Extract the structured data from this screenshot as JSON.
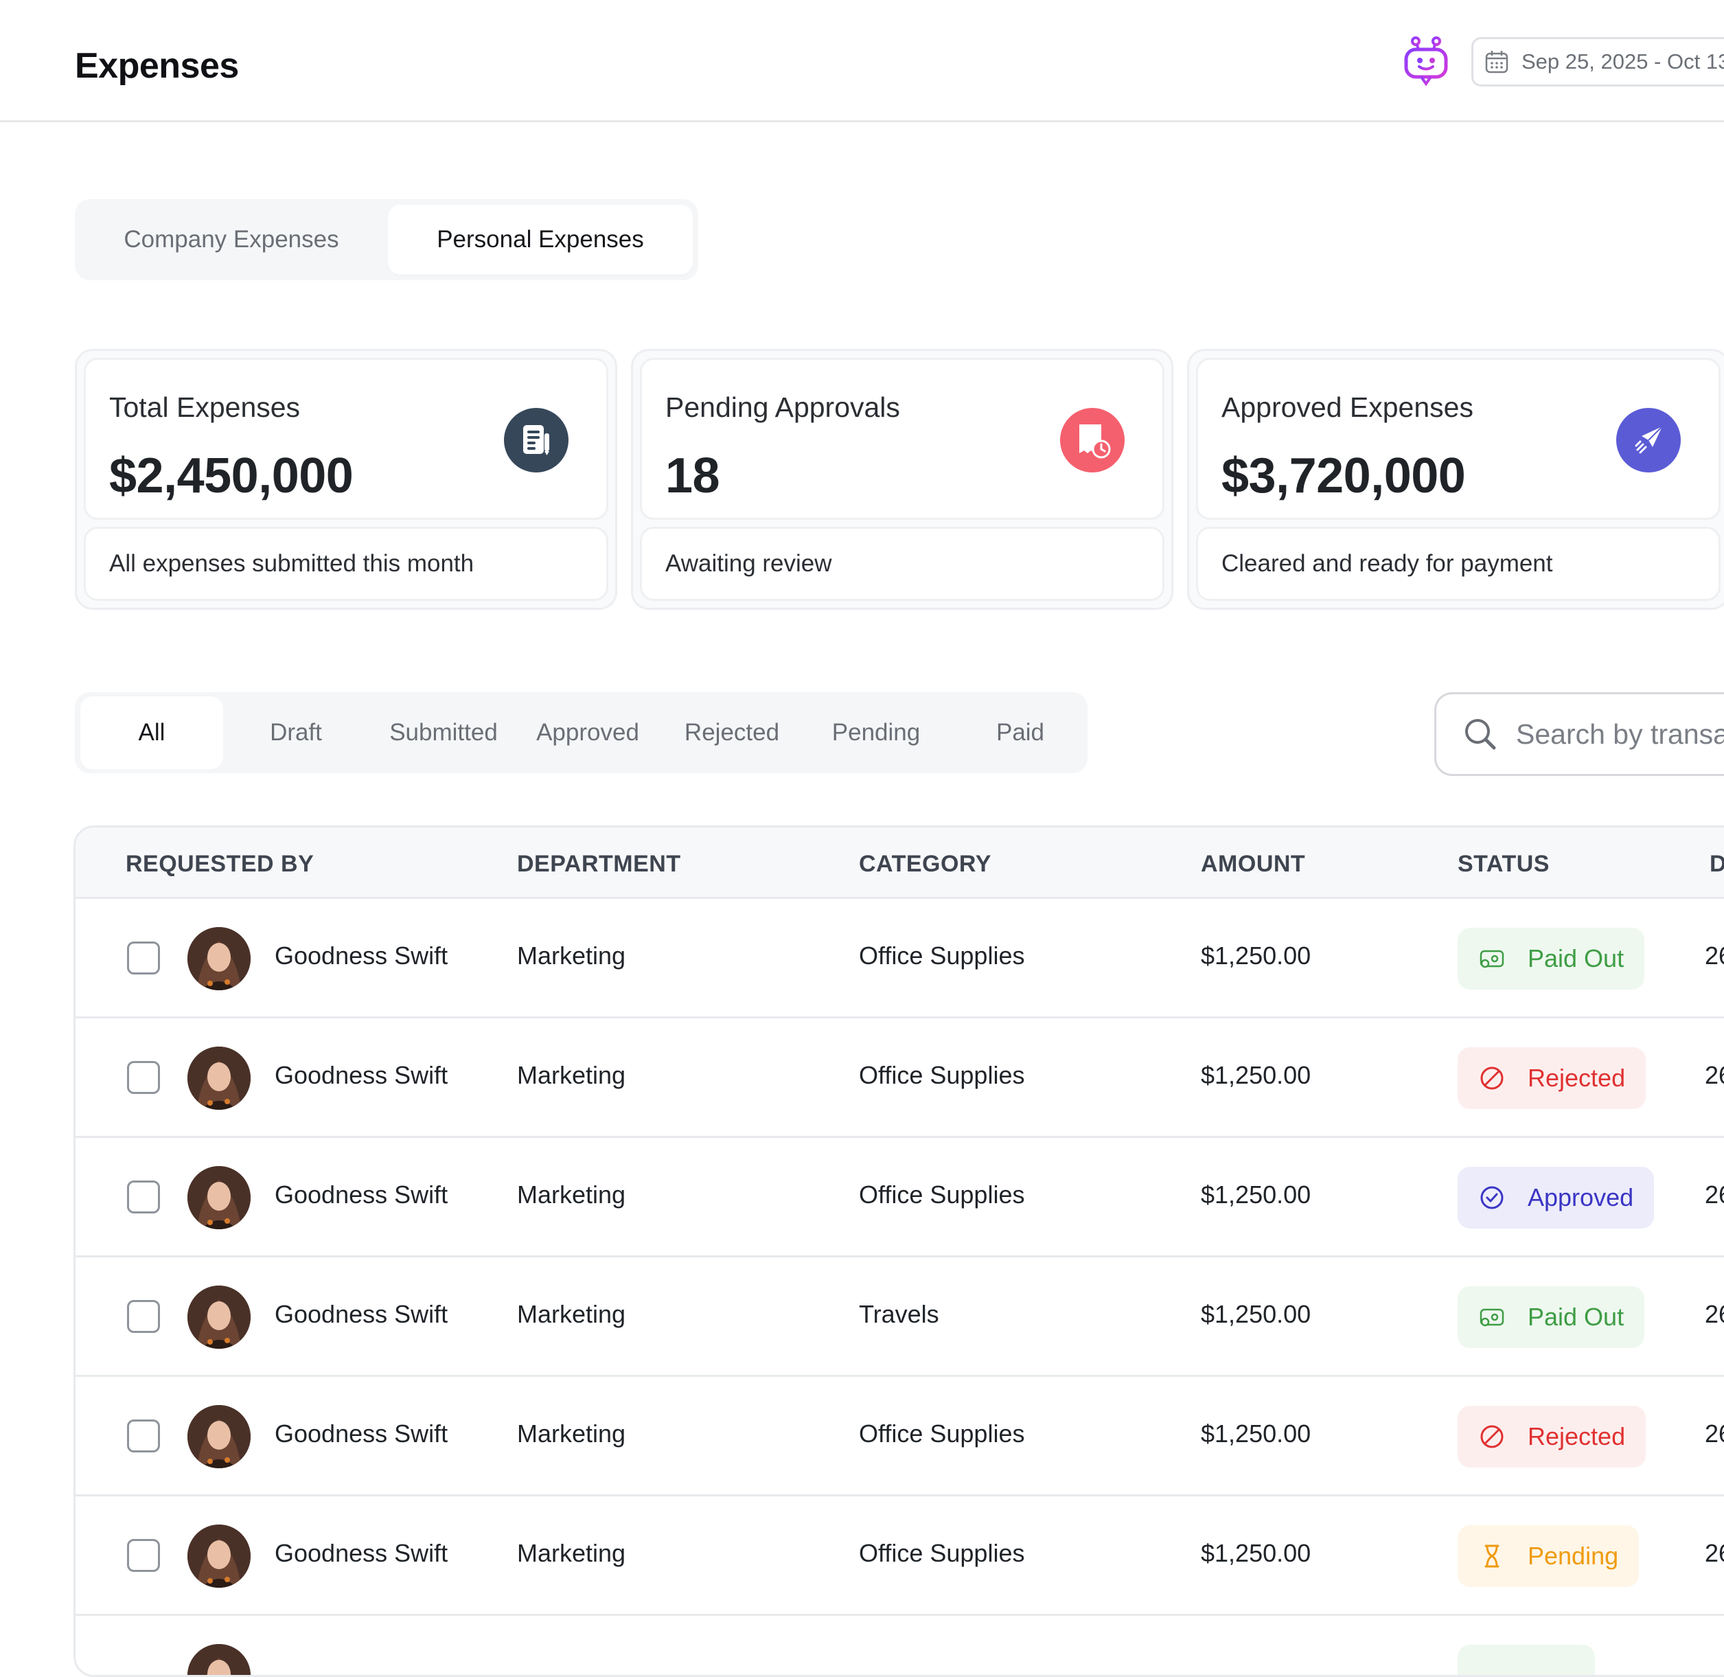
{
  "header": {
    "title": "Expenses",
    "date_range": "Sep 25, 2025 - Oct 13,"
  },
  "tabs": [
    {
      "label": "Company Expenses",
      "active": false
    },
    {
      "label": "Personal Expenses",
      "active": true
    }
  ],
  "stats": [
    {
      "label": "Total Expenses",
      "value": "$2,450,000",
      "caption": "All expenses submitted this month",
      "icon": "document-icon",
      "color": "#36475a"
    },
    {
      "label": "Pending Approvals",
      "value": "18",
      "caption": "Awaiting review",
      "icon": "receipt-clock-icon",
      "color": "#f4606d"
    },
    {
      "label": "Approved Expenses",
      "value": "$3,720,000",
      "caption": "Cleared and ready for payment",
      "icon": "send-icon",
      "color": "#5b5bd6"
    }
  ],
  "filters": [
    "All",
    "Draft",
    "Submitted",
    "Approved",
    "Rejected",
    "Pending",
    "Paid"
  ],
  "search": {
    "placeholder": "Search by transa"
  },
  "table": {
    "headers": [
      "REQUESTED BY",
      "DEPARTMENT",
      "CATEGORY",
      "AMOUNT",
      "STATUS",
      "D"
    ],
    "rows": [
      {
        "name": "Goodness Swift",
        "department": "Marketing",
        "category": "Office Supplies",
        "amount": "$1,250.00",
        "status": "Paid Out",
        "date": "26"
      },
      {
        "name": "Goodness Swift",
        "department": "Marketing",
        "category": "Office Supplies",
        "amount": "$1,250.00",
        "status": "Rejected",
        "date": "26"
      },
      {
        "name": "Goodness Swift",
        "department": "Marketing",
        "category": "Office Supplies",
        "amount": "$1,250.00",
        "status": "Approved",
        "date": "26"
      },
      {
        "name": "Goodness Swift",
        "department": "Marketing",
        "category": "Travels",
        "amount": "$1,250.00",
        "status": "Paid Out",
        "date": "26"
      },
      {
        "name": "Goodness Swift",
        "department": "Marketing",
        "category": "Office Supplies",
        "amount": "$1,250.00",
        "status": "Rejected",
        "date": "26"
      },
      {
        "name": "Goodness Swift",
        "department": "Marketing",
        "category": "Office Supplies",
        "amount": "$1,250.00",
        "status": "Pending",
        "date": "26"
      }
    ]
  }
}
